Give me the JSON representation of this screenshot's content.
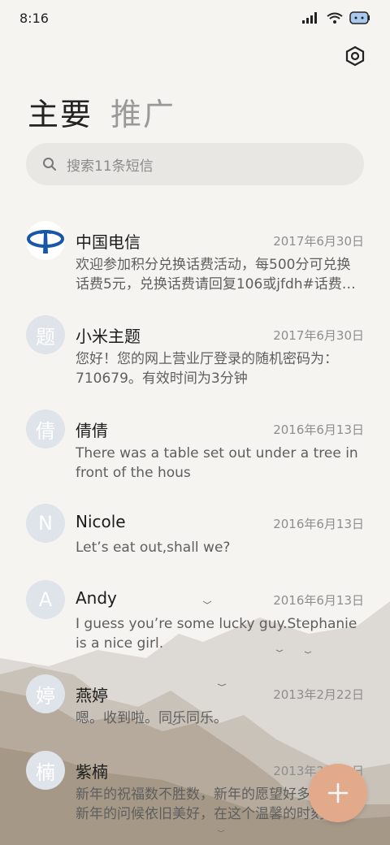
{
  "status_bar": {
    "time": "8:16"
  },
  "tabs": [
    {
      "label": "主要",
      "active": true
    },
    {
      "label": "推广",
      "active": false
    }
  ],
  "search": {
    "placeholder": "搜索11条短信"
  },
  "conversations": [
    {
      "name": "中国电信",
      "date": "2017年6月30日",
      "avatar_text": "",
      "avatar_icon": "china-telecom-logo-icon",
      "preview": [
        "欢迎参加积分兑换话费活动，每500分可兑换",
        "话费5元，兑换话费请回复106或jfdh#话费…"
      ]
    },
    {
      "name": "小米主题",
      "date": "2017年6月30日",
      "avatar_text": "题",
      "preview": [
        "您好！您的网上营业厅登录的随机密码为：",
        "710679。有效时间为3分钟"
      ]
    },
    {
      "name": "倩倩",
      "date": "2016年6月13日",
      "avatar_text": "倩",
      "preview": [
        "There was a table set out under a tree in",
        "front of the hous"
      ]
    },
    {
      "name": "Nicole",
      "date": "2016年6月13日",
      "avatar_text": "N",
      "preview": [
        "Let’s eat out,shall we?"
      ]
    },
    {
      "name": "Andy",
      "date": "2016年6月13日",
      "avatar_text": "A",
      "preview": [
        "I guess you’re some lucky guy.Stephanie",
        "is a nice girl."
      ]
    },
    {
      "name": "燕婷",
      "date": "2013年2月22日",
      "avatar_text": "婷",
      "preview": [
        "嗯。收到啦。同乐同乐。"
      ]
    },
    {
      "name": "紫楠",
      "date": "2013年2月22日",
      "avatar_text": "楠",
      "preview": [
        "新年的祝福数不胜数，新年的愿望好多好多，",
        "新年的问候依旧美好，在这个温馨的时刻"
      ]
    }
  ],
  "fab": {
    "icon": "plus-icon"
  },
  "colors": {
    "accent": "#e2a98b",
    "background": "#f5f4f1",
    "search_bg": "#e8e7e4",
    "avatar_bg": "#dfe3ea"
  }
}
